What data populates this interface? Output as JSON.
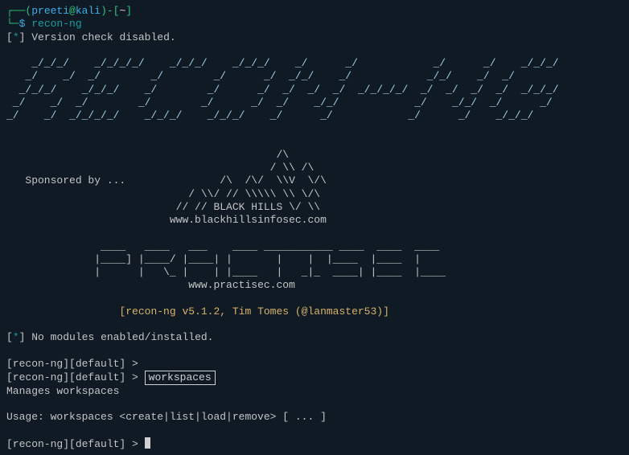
{
  "prompt": {
    "open_br": "┌──(",
    "user": "preeti",
    "at": "@",
    "host": "kali",
    "close_br": ")-[",
    "path": "~",
    "end": "]",
    "line2_lead": "└─",
    "dollar": "$ "
  },
  "cmd": "recon-ng",
  "star_open": "[",
  "star": "*",
  "star_close": "]",
  "version_line": "Version check disabled.",
  "ascii_banner": "    _/_/_/    _/_/_/_/    _/_/_/    _/_/_/    _/      _/            _/      _/    _/_/_/",
  "ascii_banner2": "   _/    _/  _/        _/        _/      _/  _/_/    _/            _/_/    _/  _/      ",
  "ascii_banner3": "  _/_/_/    _/_/_/    _/        _/      _/  _/  _/  _/  _/_/_/_/  _/  _/  _/  _/  _/_/_/",
  "ascii_banner4": " _/    _/  _/        _/        _/      _/  _/    _/_/            _/    _/_/  _/      _/",
  "ascii_banner5": "_/    _/  _/_/_/_/    _/_/_/    _/_/_/    _/      _/            _/      _/    _/_/_/   ",
  "sponsor": "Sponsored by ...",
  "blackhills_ascii1": "             /\\",
  "blackhills_ascii2": "            / \\\\ /\\",
  "blackhills_ascii3": "    /\\  /\\/  \\\\V  \\/\\",
  "blackhills_ascii4": "   / \\\\/ // \\\\\\\\\\ \\\\ \\/\\",
  "blackhills_ascii5": "  // // BLACK HILLS \\/ \\\\",
  "blackhills_url": " www.blackhillsinfosec.com",
  "practisec_ascii1": "  ____   ____   ___    ____ ___________ ____  ____  ____  ",
  "practisec_ascii2": " |____] |____/ |____| |       |    |  |____  |____  |     ",
  "practisec_ascii3": " |      |   \\_ |    | |____   |   _|_  ____| |____  |____ ",
  "practisec_url": "www.practisec.com",
  "version_info": "[recon-ng v5.1.2, Tim Tomes (@lanmaster53)]",
  "no_modules": "No modules enabled/installed.",
  "recon_prompt": "[recon-ng][default] > ",
  "workspaces": "workspaces",
  "manages": "Manages workspaces",
  "usage": "Usage: workspaces <create|list|load|remove> [ ... ]"
}
